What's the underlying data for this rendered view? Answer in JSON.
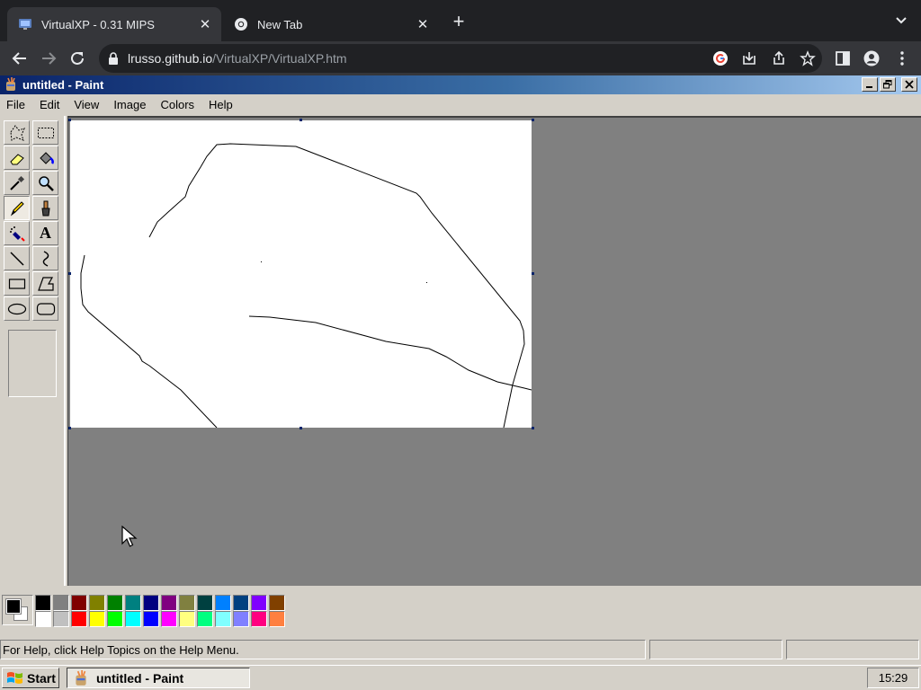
{
  "browser": {
    "tabs": [
      {
        "title": "VirtualXP - 0.31 MIPS",
        "active": true
      },
      {
        "title": "New Tab",
        "active": false
      }
    ],
    "close_glyph": "✕",
    "newtab_glyph": "+",
    "url_host": "lrusso.github.io",
    "url_path": "/VirtualXP/VirtualXP.htm"
  },
  "paint": {
    "title": "untitled - Paint",
    "menu": [
      "File",
      "Edit",
      "View",
      "Image",
      "Colors",
      "Help"
    ],
    "tools": [
      {
        "name": "free-form-select-icon"
      },
      {
        "name": "select-icon"
      },
      {
        "name": "eraser-icon"
      },
      {
        "name": "fill-with-color-icon"
      },
      {
        "name": "pick-color-icon"
      },
      {
        "name": "magnifier-icon"
      },
      {
        "name": "pencil-icon",
        "selected": true
      },
      {
        "name": "brush-icon"
      },
      {
        "name": "airbrush-icon"
      },
      {
        "name": "text-icon",
        "glyph": "A"
      },
      {
        "name": "line-icon"
      },
      {
        "name": "curve-icon"
      },
      {
        "name": "rectangle-icon"
      },
      {
        "name": "polygon-icon"
      },
      {
        "name": "ellipse-icon"
      },
      {
        "name": "rounded-rectangle-icon"
      }
    ],
    "foreground_color": "#000000",
    "background_color": "#ffffff",
    "palette_top": [
      "#000000",
      "#808080",
      "#800000",
      "#808000",
      "#008000",
      "#008080",
      "#000080",
      "#800080",
      "#808040",
      "#004040",
      "#0080ff",
      "#004080",
      "#8000ff",
      "#804000"
    ],
    "palette_bottom": [
      "#ffffff",
      "#c0c0c0",
      "#ff0000",
      "#ffff00",
      "#00ff00",
      "#00ffff",
      "#0000ff",
      "#ff00ff",
      "#ffff80",
      "#00ff80",
      "#80ffff",
      "#8080ff",
      "#ff0080",
      "#ff8040"
    ],
    "status_text": "For Help, click Help Topics on the Help Menu."
  },
  "taskbar": {
    "start_label": "Start",
    "task_label": "untitled - Paint",
    "clock": "15:29"
  }
}
